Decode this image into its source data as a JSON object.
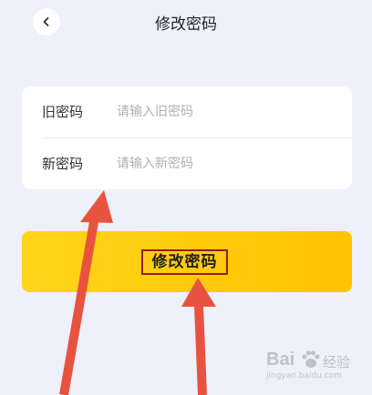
{
  "header": {
    "title": "修改密码",
    "back_icon": "chevron-left-icon"
  },
  "form": {
    "old_password": {
      "label": "旧密码",
      "placeholder": "请输入旧密码",
      "value": ""
    },
    "new_password": {
      "label": "新密码",
      "placeholder": "请输入新密码",
      "value": ""
    }
  },
  "submit": {
    "label": "修改密码"
  },
  "watermark": {
    "brand_left": "Bai",
    "brand_right": "经验",
    "url": "jingyan.baidu.com"
  },
  "colors": {
    "page_background": "#eef0fb",
    "card_background": "#ffffff",
    "button_yellow": "#ffcf10",
    "annotation_arrow": "#e8533f",
    "annotation_box": "#9b1a1a"
  }
}
